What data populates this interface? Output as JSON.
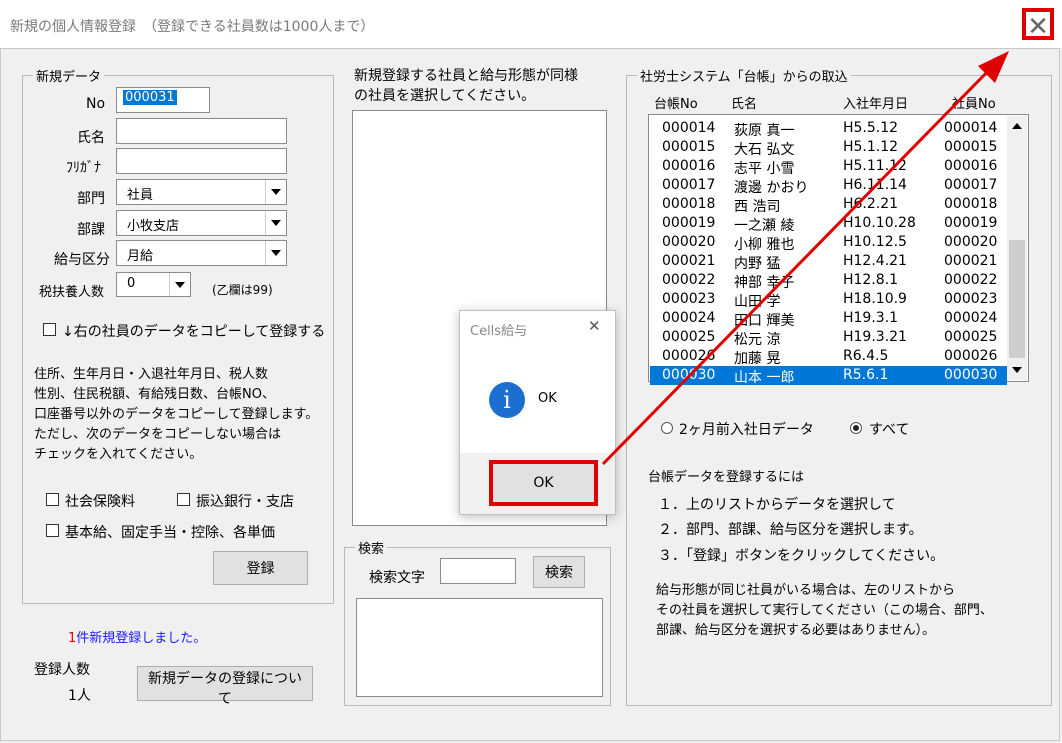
{
  "window": {
    "title": "新規の個人情報登録　（登録できる社員数は1000人まで）",
    "close_glyph": "✕"
  },
  "new_data": {
    "legend": "新規データ",
    "no_label": "No",
    "no_value": "000031",
    "name_label": "氏名",
    "name_value": "",
    "kana_label": "ﾌﾘｶﾞﾅ",
    "kana_value": "",
    "dept_label": "部門",
    "dept_value": "社員",
    "section_label": "部課",
    "section_value": "小牧支店",
    "pay_label": "給与区分",
    "pay_value": "月給",
    "dep_label": "税扶養人数",
    "dep_value": "0",
    "dep_note": "(乙欄は99)",
    "copy_check_label": "↓右の社員のデータをコピーして登録する",
    "copy_desc": "住所、生年月日・入退社年月日、税人数\n性別、住民税額、有給残日数、台帳NO、\n口座番号以外のデータをコピーして登録します。\nただし、次のデータをコピーしない場合は\nチェックを入れてください。",
    "chk_social": "社会保険料",
    "chk_bank": "振込銀行・支店",
    "chk_base": "基本給、固定手当・控除、各単価",
    "register_button": "登録"
  },
  "status": {
    "count_text": "1",
    "suffix_text": "件新規登録しました。",
    "color": "#1a1aff",
    "count_color": "#e00000"
  },
  "registered": {
    "label": "登録人数",
    "value": "1人"
  },
  "about_button": "新規データの登録について",
  "middle": {
    "heading": "新規登録する社員と給与形態が同様\nの社員を選択してください。",
    "search_legend": "検索",
    "search_label": "検索文字",
    "search_value": "",
    "search_button": "検索"
  },
  "ledger": {
    "legend": "社労士システム「台帳」からの取込",
    "headers": [
      "台帳No",
      "氏名",
      "入社年月日",
      "社員No"
    ],
    "rows": [
      [
        "000014",
        "荻原 真一",
        "H5.5.12",
        "000014"
      ],
      [
        "000015",
        "大石 弘文",
        "H5.1.12",
        "000015"
      ],
      [
        "000016",
        "志平 小雪",
        "H5.11.12",
        "000016"
      ],
      [
        "000017",
        "渡邊 かおり",
        "H6.11.14",
        "000017"
      ],
      [
        "000018",
        "西 浩司",
        "H6.2.21",
        "000018"
      ],
      [
        "000019",
        "一之瀬 綾",
        "H10.10.28",
        "000019"
      ],
      [
        "000020",
        "小柳 雅也",
        "H10.12.5",
        "000020"
      ],
      [
        "000021",
        "内野 猛",
        "H12.4.21",
        "000021"
      ],
      [
        "000022",
        "神部 幸子",
        "H12.8.1",
        "000022"
      ],
      [
        "000023",
        "山田 学",
        "H18.10.9",
        "000023"
      ],
      [
        "000024",
        "田口 輝美",
        "H19.3.1",
        "000024"
      ],
      [
        "000025",
        "松元 涼",
        "H19.3.21",
        "000025"
      ],
      [
        "000026",
        "加藤 晃",
        "R6.4.5",
        "000026"
      ],
      [
        "000030",
        "山本 一郎",
        "R5.6.1",
        "000030"
      ]
    ],
    "selected_index": 13,
    "radio_two_months": "2ヶ月前入社日データ",
    "radio_all": "すべて",
    "how_title": "台帳データを登録するには",
    "steps": [
      "１．上のリストからデータを選択して",
      "２．部門、部課、給与区分を選択します。",
      "３．「登録」ボタンをクリックしてください。"
    ],
    "note": "給与形態が同じ社員がいる場合は、左のリストから\nその社員を選択して実行してください（この場合、部門、\n部課、給与区分を選択する必要はありません）。"
  },
  "dialog": {
    "title": "Cells給与",
    "close_glyph": "✕",
    "icon_glyph": "i",
    "message": "OK",
    "ok_button": "OK"
  },
  "highlight_color": "#e10000",
  "accent_color": "#0078d7"
}
